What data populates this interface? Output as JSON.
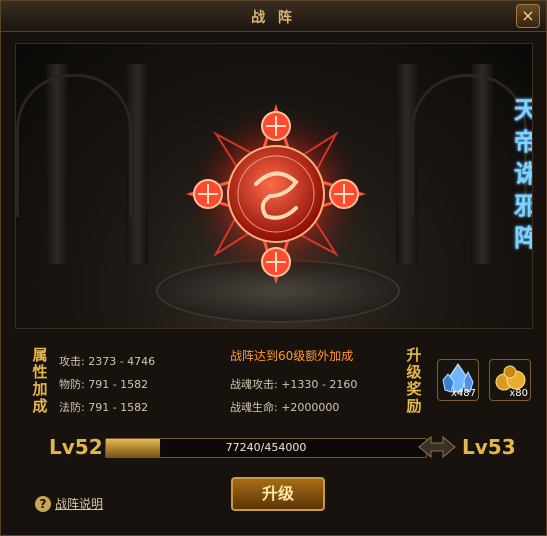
{
  "window": {
    "title": "战 阵",
    "close_label": "×"
  },
  "array": {
    "name_chars": [
      "天",
      "帝",
      "诛",
      "邪",
      "阵"
    ]
  },
  "attributes": {
    "label_chars": [
      "属",
      "性",
      "加",
      "成"
    ],
    "rows": [
      {
        "text": "攻击: 2373 - 4746"
      },
      {
        "text": "物防: 791 - 1582"
      },
      {
        "text": "法防: 791 - 1582"
      }
    ]
  },
  "bonus": {
    "heading": "战阵达到60级额外加成",
    "rows": [
      {
        "text": "战魂攻击: +1330 - 2160"
      },
      {
        "text": "战魂生命: +2000000"
      }
    ]
  },
  "rewards": {
    "label_chars": [
      "升",
      "级",
      "奖",
      "励"
    ],
    "items": [
      {
        "icon": "blue-crystal-icon",
        "count": "x487"
      },
      {
        "icon": "gold-ore-icon",
        "count": "x80"
      }
    ]
  },
  "level": {
    "current": "Lv52",
    "next": "Lv53",
    "progress_text": "77240/454000",
    "progress_fraction": 0.17
  },
  "actions": {
    "upgrade_label": "升级",
    "help_label": "战阵说明",
    "help_icon_text": "?"
  },
  "colors": {
    "gold": "#e4b64a",
    "orange": "#ff9a2e",
    "blue_title": "#7fd3ff",
    "emblem_red": "#ff3a2a"
  }
}
